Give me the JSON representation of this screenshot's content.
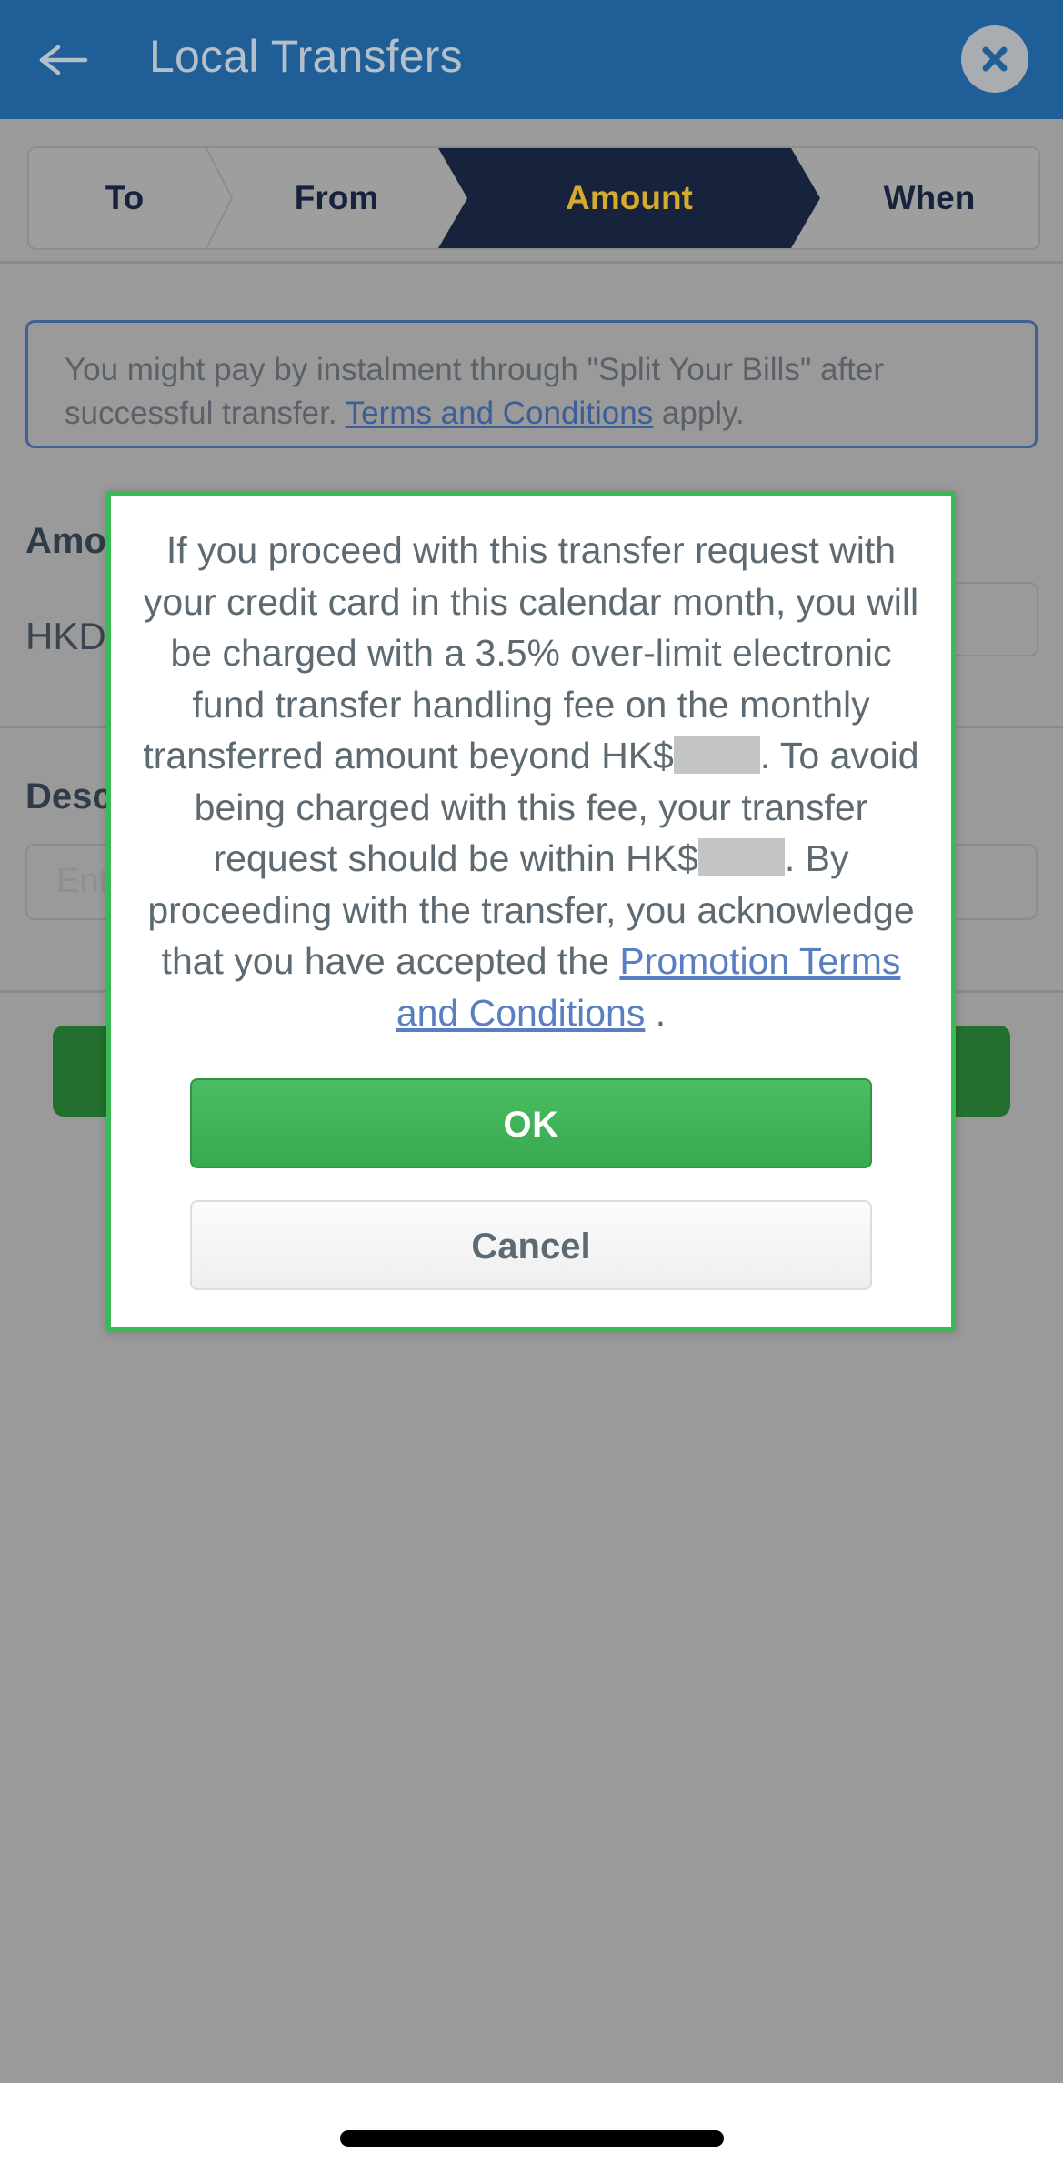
{
  "header": {
    "title": "Local Transfers",
    "back_icon": "arrow-left-icon",
    "close_icon": "close-circle-icon",
    "bg_color": "#1f5e96",
    "title_color": "#b3bfc9"
  },
  "steps": {
    "items": [
      {
        "label": "To",
        "active": false
      },
      {
        "label": "From",
        "active": false
      },
      {
        "label": "Amount",
        "active": true
      },
      {
        "label": "When",
        "active": false
      }
    ],
    "active_bg": "#17233d",
    "active_text": "#d4ab2e"
  },
  "promo_notice": {
    "text_before": "You might pay by instalment through \"Split Your Bills\" after successful transfer. ",
    "link_label": "Terms and Conditions",
    "text_after": " apply.",
    "border_color": "#3f6391"
  },
  "form": {
    "amount_label": "Amount",
    "currency": "HKD",
    "amount_value": "",
    "description_label": "Description",
    "description_placeholder": "Enter"
  },
  "dialog": {
    "message_part_1": "If you proceed with this transfer request with your credit card in this calendar month, you will be charged with a 3.5% over-limit electronic fund transfer handling fee on the monthly transferred amount beyond HK$",
    "redacted_1": "",
    "message_part_2": ". To avoid being charged with this fee, your transfer request should be within HK$",
    "redacted_2": "",
    "message_part_3": ". By proceeding with the transfer, you acknowledge that you have accepted the ",
    "link_label": "Promotion Terms and Conditions",
    "message_part_4": " .",
    "ok_label": "OK",
    "cancel_label": "Cancel",
    "border_color": "#3aba56",
    "ok_color": "#40b357",
    "link_color": "#5a7fc0"
  },
  "system": {
    "home_indicator": "home-indicator"
  }
}
